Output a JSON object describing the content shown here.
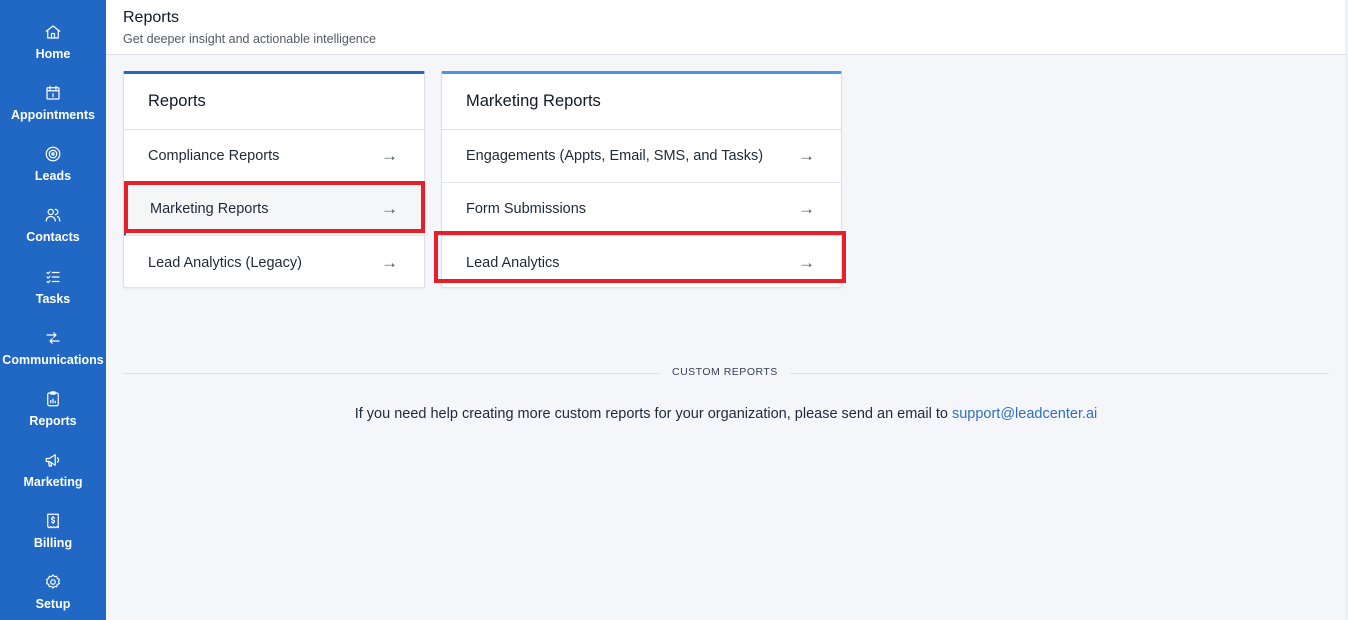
{
  "sidebar": {
    "items": [
      {
        "label": "Home",
        "icon": "home-icon"
      },
      {
        "label": "Appointments",
        "icon": "calendar-icon"
      },
      {
        "label": "Leads",
        "icon": "target-icon"
      },
      {
        "label": "Contacts",
        "icon": "users-icon"
      },
      {
        "label": "Tasks",
        "icon": "checklist-icon"
      },
      {
        "label": "Communications",
        "icon": "arrows-exchange-icon"
      },
      {
        "label": "Reports",
        "icon": "clipboard-chart-icon"
      },
      {
        "label": "Marketing",
        "icon": "megaphone-icon"
      },
      {
        "label": "Billing",
        "icon": "receipt-dollar-icon"
      },
      {
        "label": "Setup",
        "icon": "gear-icon"
      }
    ]
  },
  "header": {
    "title": "Reports",
    "subtitle": "Get deeper insight and actionable intelligence"
  },
  "cards": [
    {
      "title": "Reports",
      "items": [
        {
          "label": "Compliance Reports",
          "arrow": "→"
        },
        {
          "label": "Marketing Reports",
          "arrow": "→",
          "active": true
        },
        {
          "label": "Lead Analytics (Legacy)",
          "arrow": "→"
        }
      ]
    },
    {
      "title": "Marketing Reports",
      "items": [
        {
          "label": "Engagements (Appts, Email, SMS, and Tasks)",
          "arrow": "→"
        },
        {
          "label": "Form Submissions",
          "arrow": "→"
        },
        {
          "label": "Lead Analytics",
          "arrow": "→"
        }
      ]
    }
  ],
  "custom_reports": {
    "label": "CUSTOM REPORTS",
    "help_text": "If you need help creating more custom reports for your organization, please send an email to ",
    "email": "support@leadcenter.ai"
  },
  "colors": {
    "sidebar": "#2068c4",
    "highlight": "#e4202a",
    "link": "#2f6fc0"
  }
}
